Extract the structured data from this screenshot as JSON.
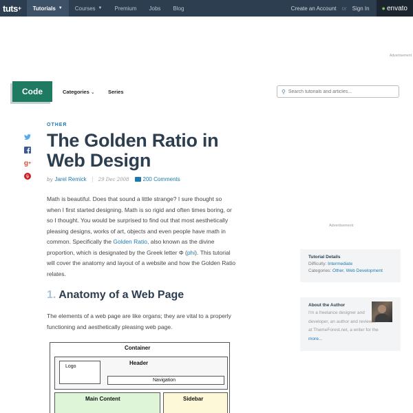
{
  "topnav": {
    "logo": "tuts",
    "logo_plus": "+",
    "items": [
      {
        "label": "Tutorials",
        "active": true,
        "dropdown": true
      },
      {
        "label": "Courses",
        "dropdown": true
      },
      {
        "label": "Premium"
      },
      {
        "label": "Jobs"
      },
      {
        "label": "Blog"
      }
    ],
    "create_account": "Create an Account",
    "or": "or",
    "sign_in": "Sign In",
    "envato": "envato"
  },
  "ad_label_top": "Advertisement",
  "subheader": {
    "badge": "Code",
    "categories": "Categories",
    "series": "Series",
    "search_placeholder": "Search tutorials and articles..."
  },
  "social": [
    "twitter-icon",
    "facebook-icon",
    "google-plus-icon",
    "pinterest-icon"
  ],
  "article": {
    "category": "OTHER",
    "title": "The Golden Ratio in Web Design",
    "by": "by",
    "author": "Jarel Remick",
    "date": "29 Dec 2008",
    "comments": "200 Comments",
    "para1_a": "Math is beautiful. Does that sound a little strange? I sure thought so when I first started designing. Math is so rigid and often times boring, or so I thought. You would be surprised to find out that most aesthetically pleasing designs, works of art, objects and even people have math in common. Specifically the ",
    "para1_link": "Golden Ratio",
    "para1_b": ", also known as the divine proportion, which is designated by the Greek letter Φ (",
    "para1_link2": "phi",
    "para1_c": "). This tutorial will cover the anatomy and layout of a website and how the Golden Ratio relates.",
    "section_num": "1.",
    "section_title": "Anatomy of a Web Page",
    "para2": "The elements of a web page are like organs; they are vital to a properly functioning and aesthetically pleasing web page."
  },
  "diagram": {
    "container": "Container",
    "logo": "Logo",
    "header": "Header",
    "navigation": "Navigation",
    "main_content": "Main Content",
    "sidebar": "Sidebar"
  },
  "sidebar": {
    "ad_label": "Advertisement",
    "details_title": "Tutorial Details",
    "difficulty_label": "Difficulty: ",
    "difficulty": "Intermediate",
    "categories_label": "Categories: ",
    "category1": "Other",
    "category_sep": ", ",
    "category2": "Web Development",
    "author_title": "About the Author",
    "author_desc": "I'm a freelance designer and developer, an author and reviewer at ThemeForest.net, a writer for the",
    "author_more": "more..."
  },
  "colors": {
    "topbar": "#2c3e50",
    "accent": "#1c7ab0",
    "code_badge": "#1f7a62"
  }
}
